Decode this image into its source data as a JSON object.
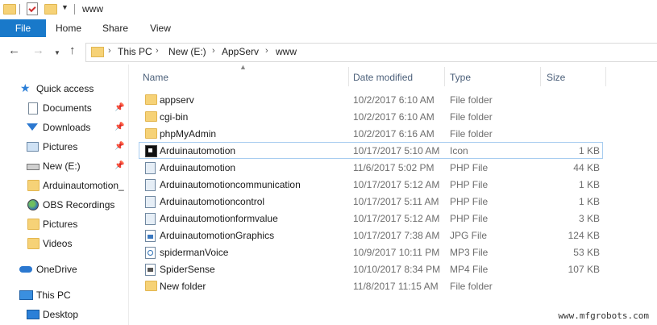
{
  "window": {
    "title": "www"
  },
  "ribbon": {
    "tabs": [
      "File",
      "Home",
      "Share",
      "View"
    ]
  },
  "nav": {
    "back_icon": "back-arrow-icon",
    "forward_icon": "forward-arrow-icon",
    "recent_icon": "chevron-down-icon",
    "up_icon": "up-arrow-icon",
    "breadcrumb": [
      "This PC",
      "New (E:)",
      "AppServ",
      "www"
    ]
  },
  "sidebar": {
    "items": [
      {
        "label": "Quick access",
        "icon": "star-icon",
        "pinned": false
      },
      {
        "label": "Documents",
        "icon": "documents-icon",
        "pinned": true
      },
      {
        "label": "Downloads",
        "icon": "downloads-icon",
        "pinned": true
      },
      {
        "label": "Pictures",
        "icon": "pictures-icon",
        "pinned": true
      },
      {
        "label": "New (E:)",
        "icon": "drive-icon",
        "pinned": true
      },
      {
        "label": "Arduinautomotion_",
        "icon": "folder-icon",
        "pinned": false
      },
      {
        "label": "OBS Recordings",
        "icon": "obs-icon",
        "pinned": false
      },
      {
        "label": "Pictures",
        "icon": "folder-icon",
        "pinned": false
      },
      {
        "label": "Videos",
        "icon": "folder-icon",
        "pinned": false
      },
      {
        "label": "OneDrive",
        "icon": "cloud-icon",
        "pinned": false
      },
      {
        "label": "This PC",
        "icon": "computer-icon",
        "pinned": false
      },
      {
        "label": "Desktop",
        "icon": "desktop-icon",
        "pinned": false
      }
    ]
  },
  "columns": {
    "name": "Name",
    "date": "Date modified",
    "type": "Type",
    "size": "Size"
  },
  "files": [
    {
      "name": "appserv",
      "date": "10/2/2017 6:10 AM",
      "type": "File folder",
      "size": "",
      "icon": "folder-icon"
    },
    {
      "name": "cgi-bin",
      "date": "10/2/2017 6:10 AM",
      "type": "File folder",
      "size": "",
      "icon": "folder-icon"
    },
    {
      "name": "phpMyAdmin",
      "date": "10/2/2017 6:16 AM",
      "type": "File folder",
      "size": "",
      "icon": "folder-icon"
    },
    {
      "name": "Arduinautomotion",
      "date": "10/17/2017 5:10 AM",
      "type": "Icon",
      "size": "1 KB",
      "icon": "ico-file-icon",
      "selected": true
    },
    {
      "name": "Arduinautomotion",
      "date": "11/6/2017 5:02 PM",
      "type": "PHP File",
      "size": "44 KB",
      "icon": "php-file-icon"
    },
    {
      "name": "Arduinautomotioncommunication",
      "date": "10/17/2017 5:12 AM",
      "type": "PHP File",
      "size": "1 KB",
      "icon": "php-file-icon"
    },
    {
      "name": "Arduinautomotioncontrol",
      "date": "10/17/2017 5:11 AM",
      "type": "PHP File",
      "size": "1 KB",
      "icon": "php-file-icon"
    },
    {
      "name": "Arduinautomotionformvalue",
      "date": "10/17/2017 5:12 AM",
      "type": "PHP File",
      "size": "3 KB",
      "icon": "php-file-icon"
    },
    {
      "name": "ArduinautomotionGraphics",
      "date": "10/17/2017 7:38 AM",
      "type": "JPG File",
      "size": "124 KB",
      "icon": "jpg-file-icon"
    },
    {
      "name": "spidermanVoice",
      "date": "10/9/2017 10:11 PM",
      "type": "MP3 File",
      "size": "53 KB",
      "icon": "mp3-file-icon"
    },
    {
      "name": "SpiderSense",
      "date": "10/10/2017 8:34 PM",
      "type": "MP4 File",
      "size": "107 KB",
      "icon": "mp4-file-icon"
    },
    {
      "name": "New folder",
      "date": "11/8/2017 11:15 AM",
      "type": "File folder",
      "size": "",
      "icon": "folder-icon"
    }
  ],
  "watermark": "www.mfgrobots.com",
  "colors": {
    "accent": "#1979ca",
    "folder": "#f6d277",
    "header_text": "#4c607a",
    "selection_border": "#a8cdf0"
  }
}
